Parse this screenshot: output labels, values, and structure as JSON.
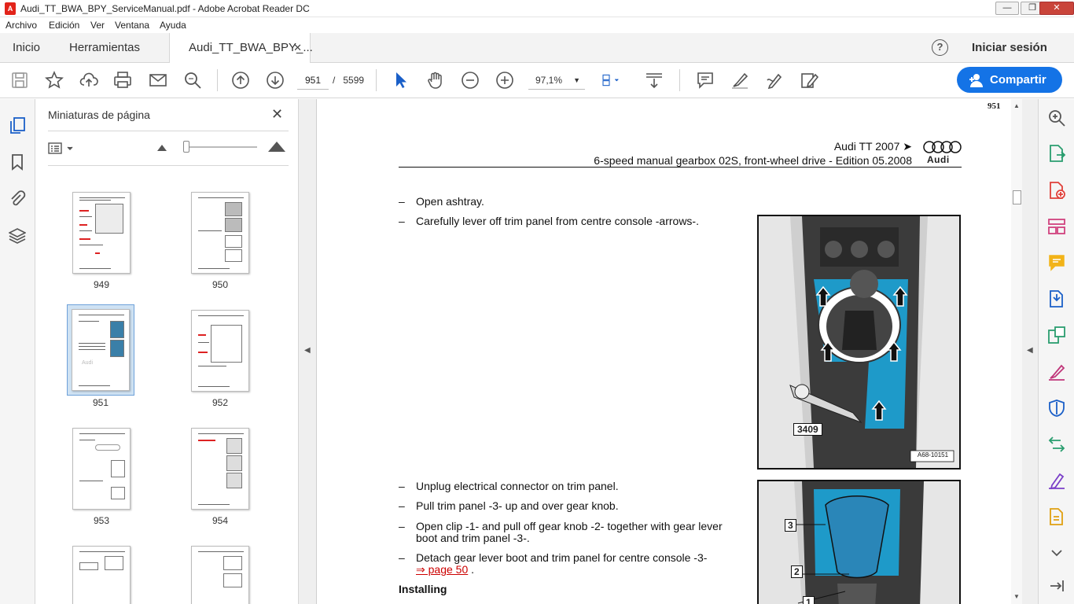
{
  "window": {
    "title": "Audi_TT_BWA_BPY_ServiceManual.pdf - Adobe Acrobat Reader DC",
    "app_icon": "adobe-acrobat-icon",
    "controls": [
      "minimize",
      "restore",
      "close"
    ]
  },
  "menu": [
    "Archivo",
    "Edición",
    "Ver",
    "Ventana",
    "Ayuda"
  ],
  "tabs": {
    "home": "Inicio",
    "tools": "Herramientas",
    "document": "Audi_TT_BWA_BPY_..."
  },
  "account": {
    "help_icon": "help-icon",
    "signin": "Iniciar sesión"
  },
  "toolbar": {
    "page_current": "951",
    "page_separator": "/",
    "page_total": "5599",
    "zoom": "97,1%",
    "share_label": "Compartir",
    "accent": "#1473e6"
  },
  "thumbnails_panel": {
    "title": "Miniaturas de página",
    "pages": [
      "949",
      "950",
      "951",
      "952",
      "953",
      "954"
    ],
    "selected": "951"
  },
  "document_page": {
    "page_number": "951",
    "header_line1": "Audi TT 2007 ➤",
    "header_line2": "6-speed manual gearbox 02S, front-wheel drive - Edition 05.2008",
    "brand": "Audi",
    "steps_top": [
      "Open ashtray.",
      "Carefully lever off trim panel from centre console -arrows-."
    ],
    "steps_bottom": [
      "Unplug electrical connector on trim panel.",
      "Pull trim panel -3- up and over gear knob.",
      "Open clip -1- and pull off gear knob -2- together with gear lever",
      "boot and trim panel -3-.",
      "Detach gear lever boot and trim panel for centre console -3-",
      "⇒ page 50",
      "."
    ],
    "heading_installing": "Installing",
    "figure1": {
      "tool_label": "3409",
      "code": "A68-10151"
    },
    "figure2": {
      "labels": [
        "3",
        "2",
        "1"
      ]
    }
  },
  "right_rail_icons": [
    "zoom-icon",
    "export-pdf-icon",
    "create-pdf-icon",
    "organize-pages-icon",
    "comment-icon",
    "compress-icon",
    "edit-pdf-icon",
    "fill-sign-icon",
    "protect-icon",
    "convert-icon",
    "sign-icon",
    "more-tools-icon",
    "expand-icon"
  ]
}
